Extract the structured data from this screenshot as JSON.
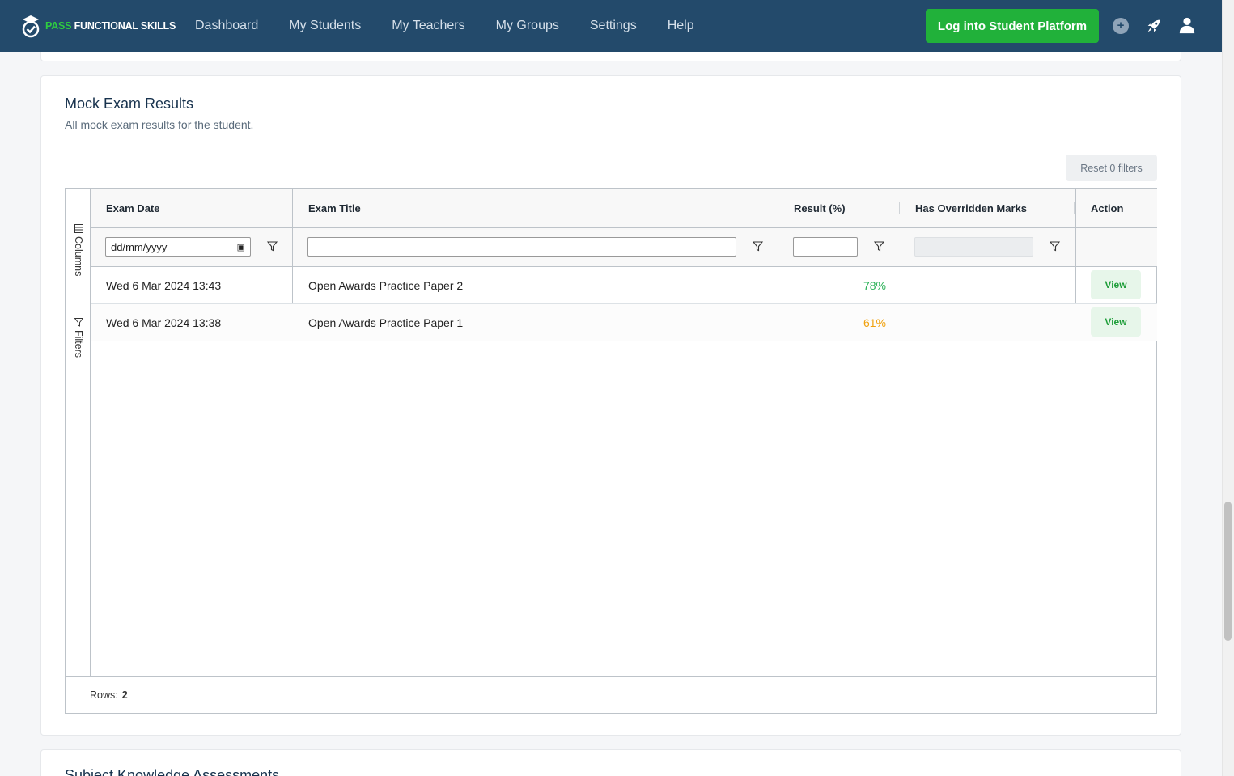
{
  "brand": {
    "pass": "PASS",
    "rest": "FUNCTIONAL SKILLS"
  },
  "nav": {
    "links": [
      "Dashboard",
      "My Students",
      "My Teachers",
      "My Groups",
      "Settings",
      "Help"
    ],
    "login_label": "Log into Student Platform",
    "plus_symbol": "+"
  },
  "colors": {
    "nav_bg": "#234a6b",
    "accent_green": "#21b13a",
    "result_good": "#2ab157",
    "result_mid": "#f0a10e"
  },
  "section": {
    "title": "Mock Exam Results",
    "subtitle": "All mock exam results for the student.",
    "reset_label": "Reset 0 filters"
  },
  "grid": {
    "side_tabs": [
      "Columns",
      "Filters"
    ],
    "columns": [
      "Exam Date",
      "Exam Title",
      "Result (%)",
      "Has Overridden Marks",
      "Action"
    ],
    "filters": {
      "date_placeholder": "dd/mm/yyyy",
      "title_value": "",
      "result_value": ""
    },
    "rows": [
      {
        "date": "Wed 6 Mar 2024 13:43",
        "title": "Open Awards Practice Paper 2",
        "result": "78%",
        "overridden": "",
        "action": "View"
      },
      {
        "date": "Wed 6 Mar 2024 13:38",
        "title": "Open Awards Practice Paper 1",
        "result": "61%",
        "overridden": "",
        "action": "View"
      }
    ],
    "footer_label": "Rows:",
    "row_count": "2"
  },
  "next_section": {
    "title": "Subject Knowledge Assessments"
  }
}
